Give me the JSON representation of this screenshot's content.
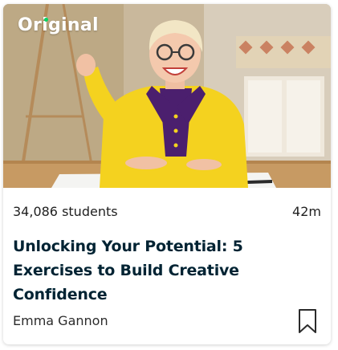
{
  "card": {
    "badge": "Original",
    "students": "34,086 students",
    "duration": "42m",
    "title": "Unlocking Your Potential: 5 Exercises to Build Creative Confidence",
    "teacher": "Emma Gannon",
    "bookmark_icon": "bookmark-icon",
    "brand_green": "#00d563",
    "title_color": "#002333"
  }
}
